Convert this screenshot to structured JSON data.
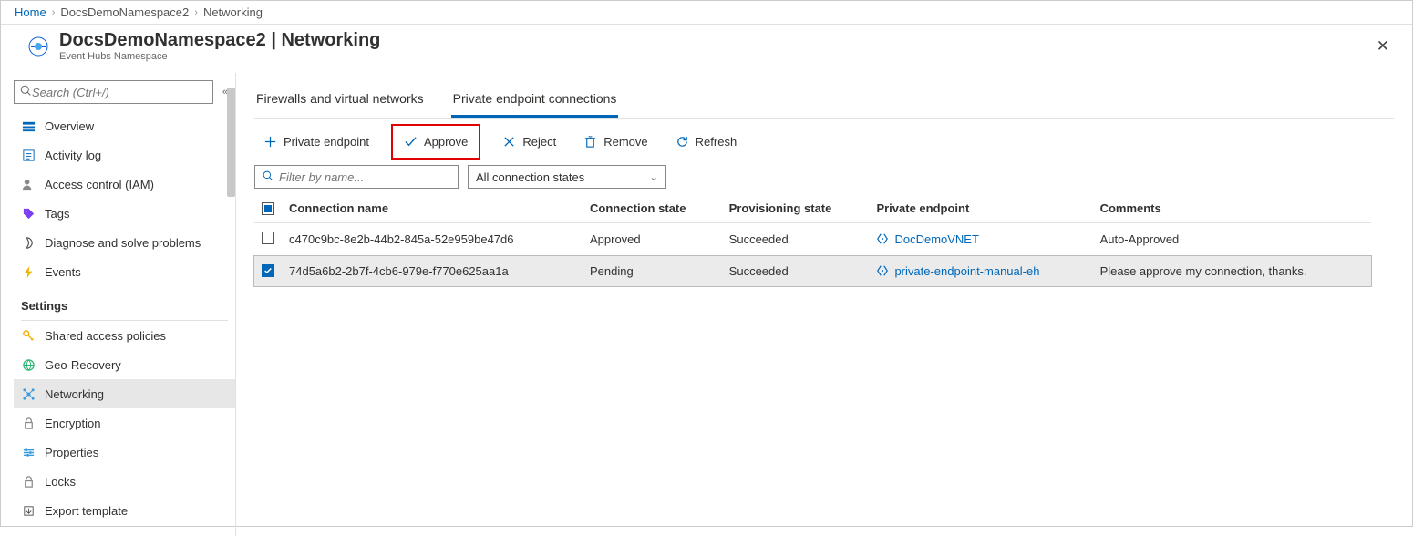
{
  "breadcrumb": {
    "home": "Home",
    "ns": "DocsDemoNamespace2",
    "current": "Networking"
  },
  "header": {
    "title": "DocsDemoNamespace2 | Networking",
    "subtitle": "Event Hubs Namespace"
  },
  "sidebar": {
    "search_placeholder": "Search (Ctrl+/)",
    "items_top": [
      {
        "label": "Overview",
        "icon": "overview"
      },
      {
        "label": "Activity log",
        "icon": "log"
      },
      {
        "label": "Access control (IAM)",
        "icon": "iam"
      },
      {
        "label": "Tags",
        "icon": "tag"
      },
      {
        "label": "Diagnose and solve problems",
        "icon": "diag"
      },
      {
        "label": "Events",
        "icon": "events"
      }
    ],
    "section": "Settings",
    "items_settings": [
      {
        "label": "Shared access policies",
        "icon": "key"
      },
      {
        "label": "Geo-Recovery",
        "icon": "geo"
      },
      {
        "label": "Networking",
        "icon": "net",
        "active": true
      },
      {
        "label": "Encryption",
        "icon": "lock"
      },
      {
        "label": "Properties",
        "icon": "props"
      },
      {
        "label": "Locks",
        "icon": "locks"
      },
      {
        "label": "Export template",
        "icon": "export"
      }
    ]
  },
  "tabs": [
    {
      "label": "Firewalls and virtual networks"
    },
    {
      "label": "Private endpoint connections",
      "active": true
    }
  ],
  "toolbar": {
    "add": "Private endpoint",
    "approve": "Approve",
    "reject": "Reject",
    "remove": "Remove",
    "refresh": "Refresh"
  },
  "filter": {
    "placeholder": "Filter by name...",
    "state_label": "All connection states"
  },
  "table": {
    "headers": [
      "Connection name",
      "Connection state",
      "Provisioning state",
      "Private endpoint",
      "Comments"
    ],
    "rows": [
      {
        "checked": false,
        "name": "c470c9bc-8e2b-44b2-845a-52e959be47d6",
        "state": "Approved",
        "prov": "Succeeded",
        "endpoint": "DocDemoVNET",
        "comments": "Auto-Approved"
      },
      {
        "checked": true,
        "name": "74d5a6b2-2b7f-4cb6-979e-f770e625aa1a",
        "state": "Pending",
        "prov": "Succeeded",
        "endpoint": "private-endpoint-manual-eh",
        "comments": "Please approve my connection, thanks."
      }
    ]
  }
}
